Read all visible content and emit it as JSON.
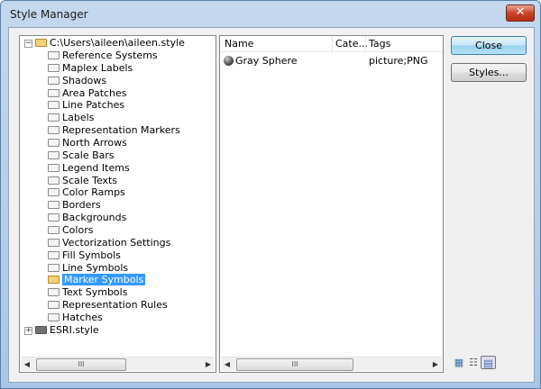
{
  "window": {
    "title": "Style Manager",
    "close_glyph": "✕"
  },
  "tree": {
    "root": "C:\\Users\\aileen\\aileen.style",
    "items": [
      "Reference Systems",
      "Maplex Labels",
      "Shadows",
      "Area Patches",
      "Line Patches",
      "Labels",
      "Representation Markers",
      "North Arrows",
      "Scale Bars",
      "Legend Items",
      "Scale Texts",
      "Color Ramps",
      "Borders",
      "Backgrounds",
      "Colors",
      "Vectorization Settings",
      "Fill Symbols",
      "Line Symbols",
      "Marker Symbols",
      "Text Symbols",
      "Representation Rules",
      "Hatches"
    ],
    "selected_index": 18,
    "second_root": "ESRI.style"
  },
  "list": {
    "columns": [
      "Name",
      "Cate...",
      "Tags"
    ],
    "rows": [
      {
        "name": "Gray Sphere",
        "category": "",
        "tags": "picture;PNG"
      }
    ]
  },
  "buttons": {
    "close": "Close",
    "styles": "Styles..."
  },
  "scroll": {
    "thumb_grip": "III",
    "left": "◀",
    "right": "▶"
  },
  "views": {
    "large_icons": "▦",
    "list": "☷",
    "report": "▤"
  }
}
